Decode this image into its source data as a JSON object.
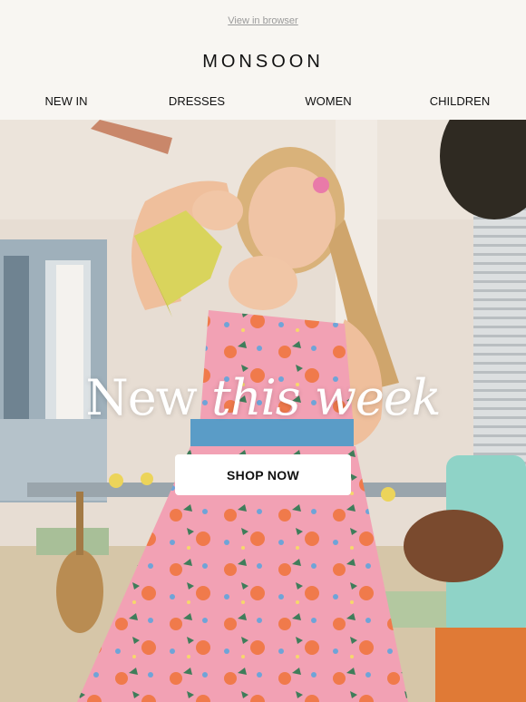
{
  "header": {
    "view_in_browser": "View in browser",
    "brand": "MONSOON"
  },
  "nav": {
    "items": [
      "NEW IN",
      "DRESSES",
      "WOMEN",
      "CHILDREN"
    ]
  },
  "hero": {
    "headline_part1": "New",
    "headline_part2": "this week",
    "cta_label": "SHOP NOW"
  },
  "colors": {
    "background": "#f8f6f2",
    "text": "#111111",
    "dress_pink": "#f2a1b4",
    "wall": "#e7ddd3"
  }
}
